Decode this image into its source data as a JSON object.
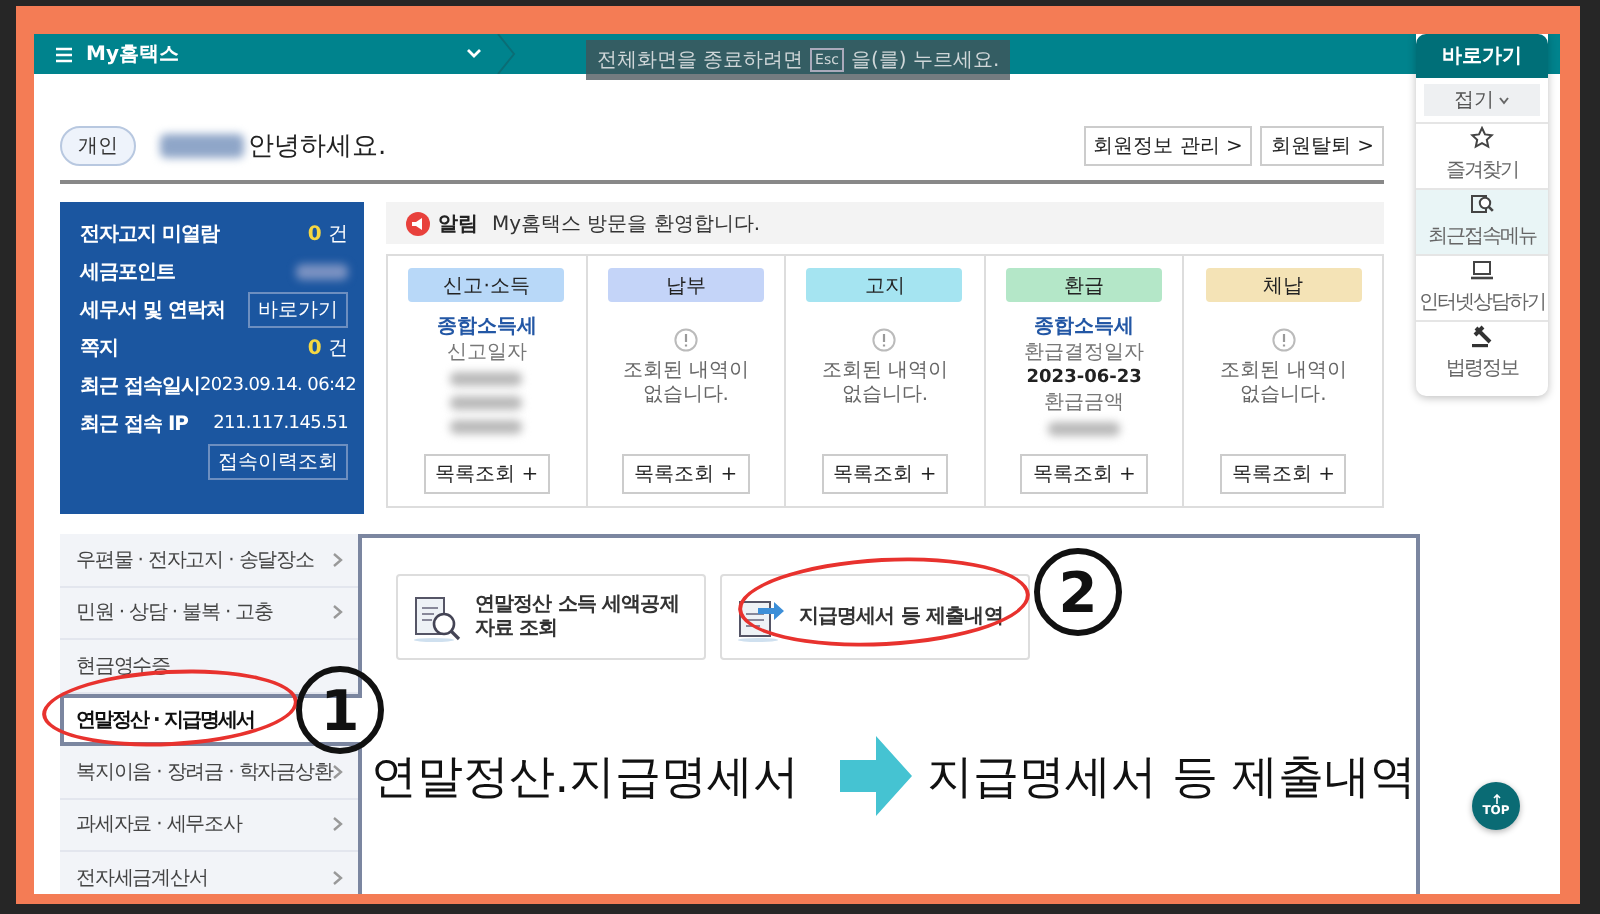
{
  "header": {
    "title": "My홈택스"
  },
  "fullscreen_notice": {
    "before": "전체화면을 종료하려면",
    "key": "Esc",
    "after": "을(를) 누르세요."
  },
  "greeting": {
    "badge": "개인",
    "text": "안녕하세요."
  },
  "account_buttons": [
    "회원정보 관리 >",
    "회원탈퇴 >"
  ],
  "summary": {
    "rows": [
      {
        "kind": "count",
        "label": "전자고지 미열람",
        "value": "0",
        "unit": "건"
      },
      {
        "kind": "blurred",
        "label": "세금포인트"
      },
      {
        "kind": "button",
        "label": "세무서 및 연락처",
        "button": "바로가기"
      },
      {
        "kind": "count",
        "label": "쪽지",
        "value": "0",
        "unit": "건"
      },
      {
        "kind": "text",
        "label": "최근 접속일시",
        "value": "2023.09.14.  06:42"
      },
      {
        "kind": "text",
        "label": "최근 접속 IP",
        "value": "211.117.145.51"
      }
    ],
    "history_button": "접속이력조회"
  },
  "notice": {
    "label": "알림",
    "text": "My홈택스 방문을 환영합니다."
  },
  "status_cards": [
    {
      "title": "신고·소득",
      "color": "#b8d8f8",
      "kind": "detail",
      "item": "종합소득세",
      "lines": [
        {
          "kind": "label",
          "text": "신고일자"
        },
        {
          "kind": "blurred"
        },
        {
          "kind": "blurred"
        },
        {
          "kind": "blurred"
        }
      ],
      "button": "목록조회 +"
    },
    {
      "title": "납부",
      "color": "#c4d4f8",
      "kind": "empty",
      "message": "조회된 내역이\n없습니다.",
      "button": "목록조회 +"
    },
    {
      "title": "고지",
      "color": "#a5e4f1",
      "kind": "empty",
      "message": "조회된 내역이\n없습니다.",
      "button": "목록조회 +"
    },
    {
      "title": "환급",
      "color": "#b4e7c8",
      "kind": "detail",
      "item": "종합소득세",
      "lines": [
        {
          "kind": "label",
          "text": "환급결정일자"
        },
        {
          "kind": "value",
          "text": "2023-06-23"
        },
        {
          "kind": "label",
          "text": "환급금액"
        },
        {
          "kind": "blurred"
        }
      ],
      "button": "목록조회 +"
    },
    {
      "title": "체납",
      "color": "#f4e3b6",
      "kind": "empty",
      "message": "조회된 내역이\n없습니다.",
      "button": "목록조회 +"
    }
  ],
  "side_menu": [
    {
      "label": "우편물 · 전자고지 · 송달장소",
      "arrow": true,
      "selected": false
    },
    {
      "label": "민원 · 상담 · 불복 · 고충",
      "arrow": true,
      "selected": false
    },
    {
      "label": "현금영수증",
      "arrow": false,
      "selected": false
    },
    {
      "label": "연말정산 · 지급명세서",
      "arrow": false,
      "selected": true
    },
    {
      "label": "복지이음 · 장려금 · 학자금상환",
      "arrow": true,
      "selected": false
    },
    {
      "label": "과세자료 · 세무조사",
      "arrow": true,
      "selected": false
    },
    {
      "label": "전자세금계산서",
      "arrow": true,
      "selected": false
    }
  ],
  "tiles": [
    {
      "label": "연말정산 소득 세액공제\n자료 조회"
    },
    {
      "label": "지급명세서 등 제출내역"
    }
  ],
  "annotation": {
    "steps": [
      "1",
      "2"
    ],
    "from": "연말정산.지급명세서",
    "to": "지급명세서 등 제출내역"
  },
  "quick_menu": {
    "title": "바로가기",
    "collapse": "접기",
    "items": [
      {
        "label": "즐겨찾기",
        "selected": false
      },
      {
        "label": "최근접속메뉴",
        "selected": true
      },
      {
        "label": "인터넷상담하기",
        "selected": false
      },
      {
        "label": "법령정보",
        "selected": false
      }
    ]
  },
  "top_button": "TOP"
}
